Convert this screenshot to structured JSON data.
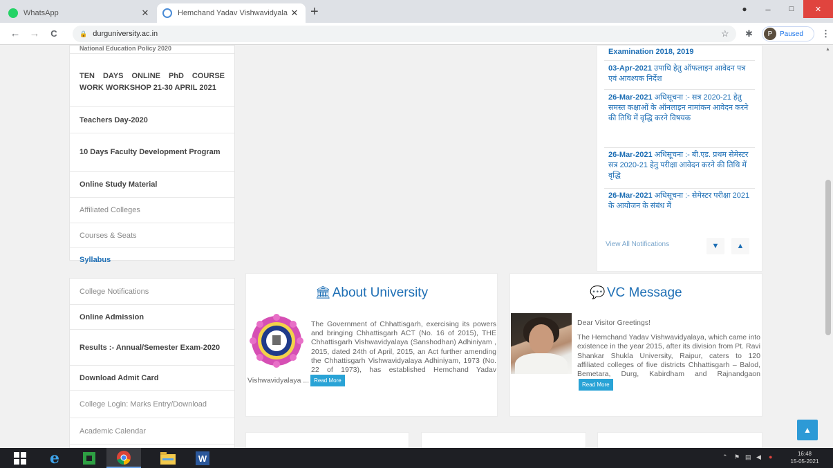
{
  "browser": {
    "tabs": [
      {
        "title": "WhatsApp",
        "active": false,
        "favicon_color": "#25d366"
      },
      {
        "title": "Hemchand Yadav Vishwavidyala",
        "active": true,
        "favicon_color": "#4a8bd6"
      }
    ],
    "new_tab": "+",
    "window_controls": {
      "minimize": "–",
      "maximize": "□",
      "close": "✕",
      "record": "●"
    },
    "nav": {
      "back": "←",
      "forward": "→",
      "reload": "C"
    },
    "address": "durguniversity.ac.in",
    "profile_initial": "P",
    "profile_label": "Paused"
  },
  "sidebar_top": [
    {
      "label": "National Education Policy 2020",
      "style": "bold"
    },
    {
      "label": "TEN DAYS ONLINE PhD COURSE WORK WORKSHOP 21-30 APRIL 2021",
      "style": "justify"
    },
    {
      "label": "Teachers Day-2020",
      "style": "bold"
    },
    {
      "label": "10 Days Faculty Development Program",
      "style": "justify"
    },
    {
      "label": "Online Study Material",
      "style": "bold"
    },
    {
      "label": "Affiliated Colleges",
      "style": "light"
    },
    {
      "label": "Courses & Seats",
      "style": "light"
    },
    {
      "label": "Syllabus",
      "style": "blue"
    }
  ],
  "sidebar_bottom": [
    {
      "label": "College Notifications",
      "style": "light"
    },
    {
      "label": "Online Admission",
      "style": "bold"
    },
    {
      "label": "Results :- Annual/Semester Exam-2020",
      "style": "bold"
    },
    {
      "label": "Download Admit Card",
      "style": "bold"
    },
    {
      "label": "College Login: Marks Entry/Download",
      "style": "light"
    },
    {
      "label": "Academic Calendar",
      "style": "light"
    }
  ],
  "notifications": {
    "items": [
      {
        "date": "",
        "text": "Examination 2018, 2019"
      },
      {
        "date": "03-Apr-2021",
        "text": "उपाधि हेतु ऑफलाइन आवेदन पत्र एवं आवश्यक निर्देश"
      },
      {
        "date": "26-Mar-2021",
        "text": "अधिसूचना :- सत्र 2020-21 हेतु समस्त कक्षाओं के ऑनलाइन नामांकन आवेदन करने की तिथि में वृद्धि करने विषयक"
      },
      {
        "date": "26-Mar-2021",
        "text": "अधिसूचना :- बी.एड. प्रथम सेमेस्टर सत्र 2020-21 हेतु परीक्षा आवेदन करने की तिथि में वृद्धि"
      },
      {
        "date": "26-Mar-2021",
        "text": "अधिसूचना :- सेमेस्टर परीक्षा 2021 के आयोजन के संबंध में"
      }
    ],
    "view_all": "View All Notifications",
    "down_icon": "▼",
    "up_icon": "▲"
  },
  "about": {
    "title": "About University",
    "icon": "🏛",
    "body": "The Government of Chhattisgarh, exercising its powers and bringing Chhattisgarh ACT (No. 16 of 2015), THE Chhattisgarh Vishwavidyalaya (Sanshodhan) Adhiniyam , 2015, dated 24th of April, 2015, an Act further amending the Chhattisgarh Vishwavidyalaya Adhiniyam, 1973 (No. 22 of 1973), has established Hemchand Yadav Vishwavidyalaya ...",
    "read_more": "Read More"
  },
  "vc": {
    "title": "VC Message",
    "icon": "💬",
    "greeting": "Dear Visitor Greetings!",
    "body": "The Hemchand Yadav Vishwavidyalaya, which came into existence in the year 2015, after its division from Pt. Ravi Shankar Shukla University, Raipur, caters to 120 affiliated colleges of five districts Chhattisgarh – Balod, Bemetara, Durg, Kabirdham and Rajnandgaon",
    "read_more": "Read More"
  },
  "scroll_top_icon": "▲",
  "taskbar": {
    "start_icon": "windows-logo",
    "apps": [
      "internet-explorer",
      "office",
      "chrome",
      "file-explorer",
      "word"
    ],
    "clock_time": "16:48",
    "clock_date": "15-05-2021"
  }
}
